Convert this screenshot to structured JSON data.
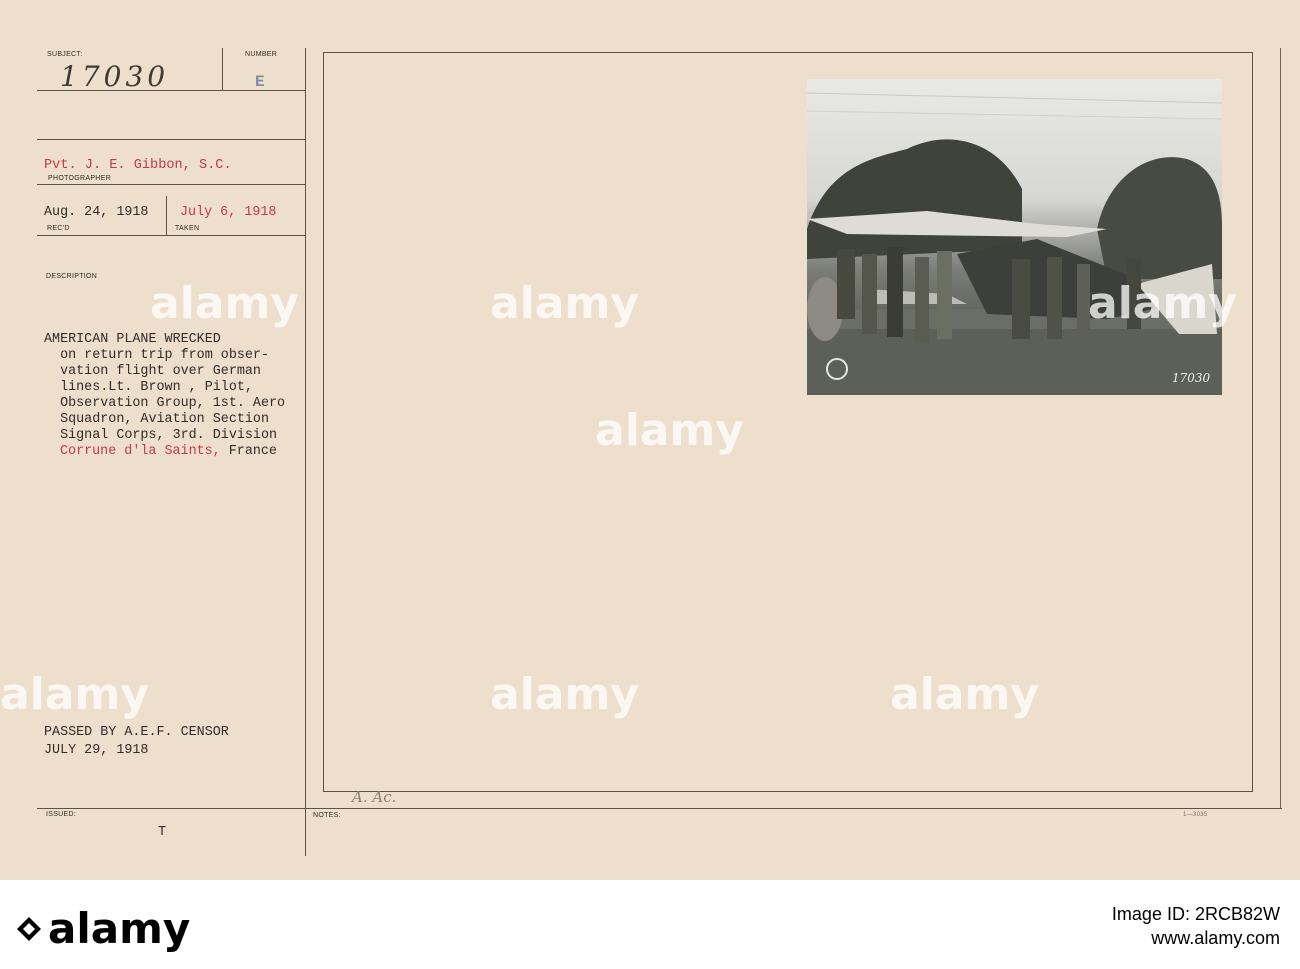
{
  "card": {
    "subject_label": "SUBJECT:",
    "subject_number": "17030",
    "number_label": "NUMBER",
    "number_value": "E",
    "photographer_value": "Pvt. J. E. Gibbon, S.C.",
    "photographer_label": "PHOTOGRAPHER",
    "recd_date": "Aug. 24, 1918",
    "recd_label": "REC'D",
    "taken_date": "July 6, 1918",
    "taken_label": "TAKEN",
    "description_label": "DESCRIPTION",
    "description_lines": [
      "AMERICAN PLANE WRECKED",
      "  on return trip from obser-",
      "  vation flight over German",
      "  lines.Lt. Brown , Pilot,",
      "  Observation Group, 1st. Aero",
      "  Squadron, Aviation Section",
      "  Signal Corps, 3rd. Division"
    ],
    "location_place": "Corrune d'la Saints,",
    "location_country": " France",
    "censor_line1": "PASSED BY A.E.F. CENSOR",
    "censor_line2": "JULY 29, 1918",
    "issued_label": "ISSUED:",
    "issued_value": "T",
    "notes_label": "NOTES:",
    "notes_handwritten": "A. Ac.",
    "form_code": "1—3035",
    "photo_number": "17030"
  },
  "watermark": "alamy",
  "footer": {
    "brand": "alamy",
    "image_id_label": "Image ID:",
    "image_id": "2RCB82W",
    "site": "www.alamy.com"
  },
  "colors": {
    "card_bg": "#eedfcd",
    "red_type": "#c23b4b",
    "rule": "#5c5248"
  }
}
